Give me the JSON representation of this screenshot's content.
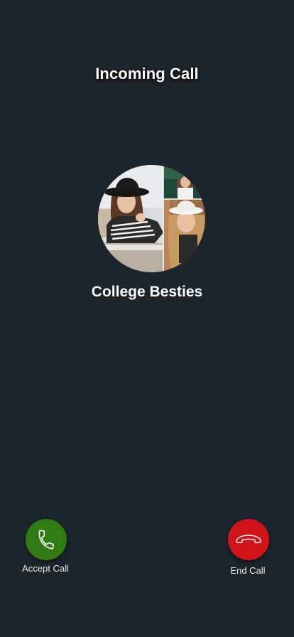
{
  "header": {
    "title": "Incoming Call"
  },
  "caller": {
    "name": "College Besties",
    "avatar": "group-photo-collage"
  },
  "actions": {
    "accept": {
      "label": "Accept Call",
      "icon": "phone-icon",
      "color": "#2f7a12"
    },
    "end": {
      "label": "End Call",
      "icon": "phone-hangup-icon",
      "color": "#d0141a"
    }
  },
  "theme": {
    "background": "#1c252c"
  }
}
